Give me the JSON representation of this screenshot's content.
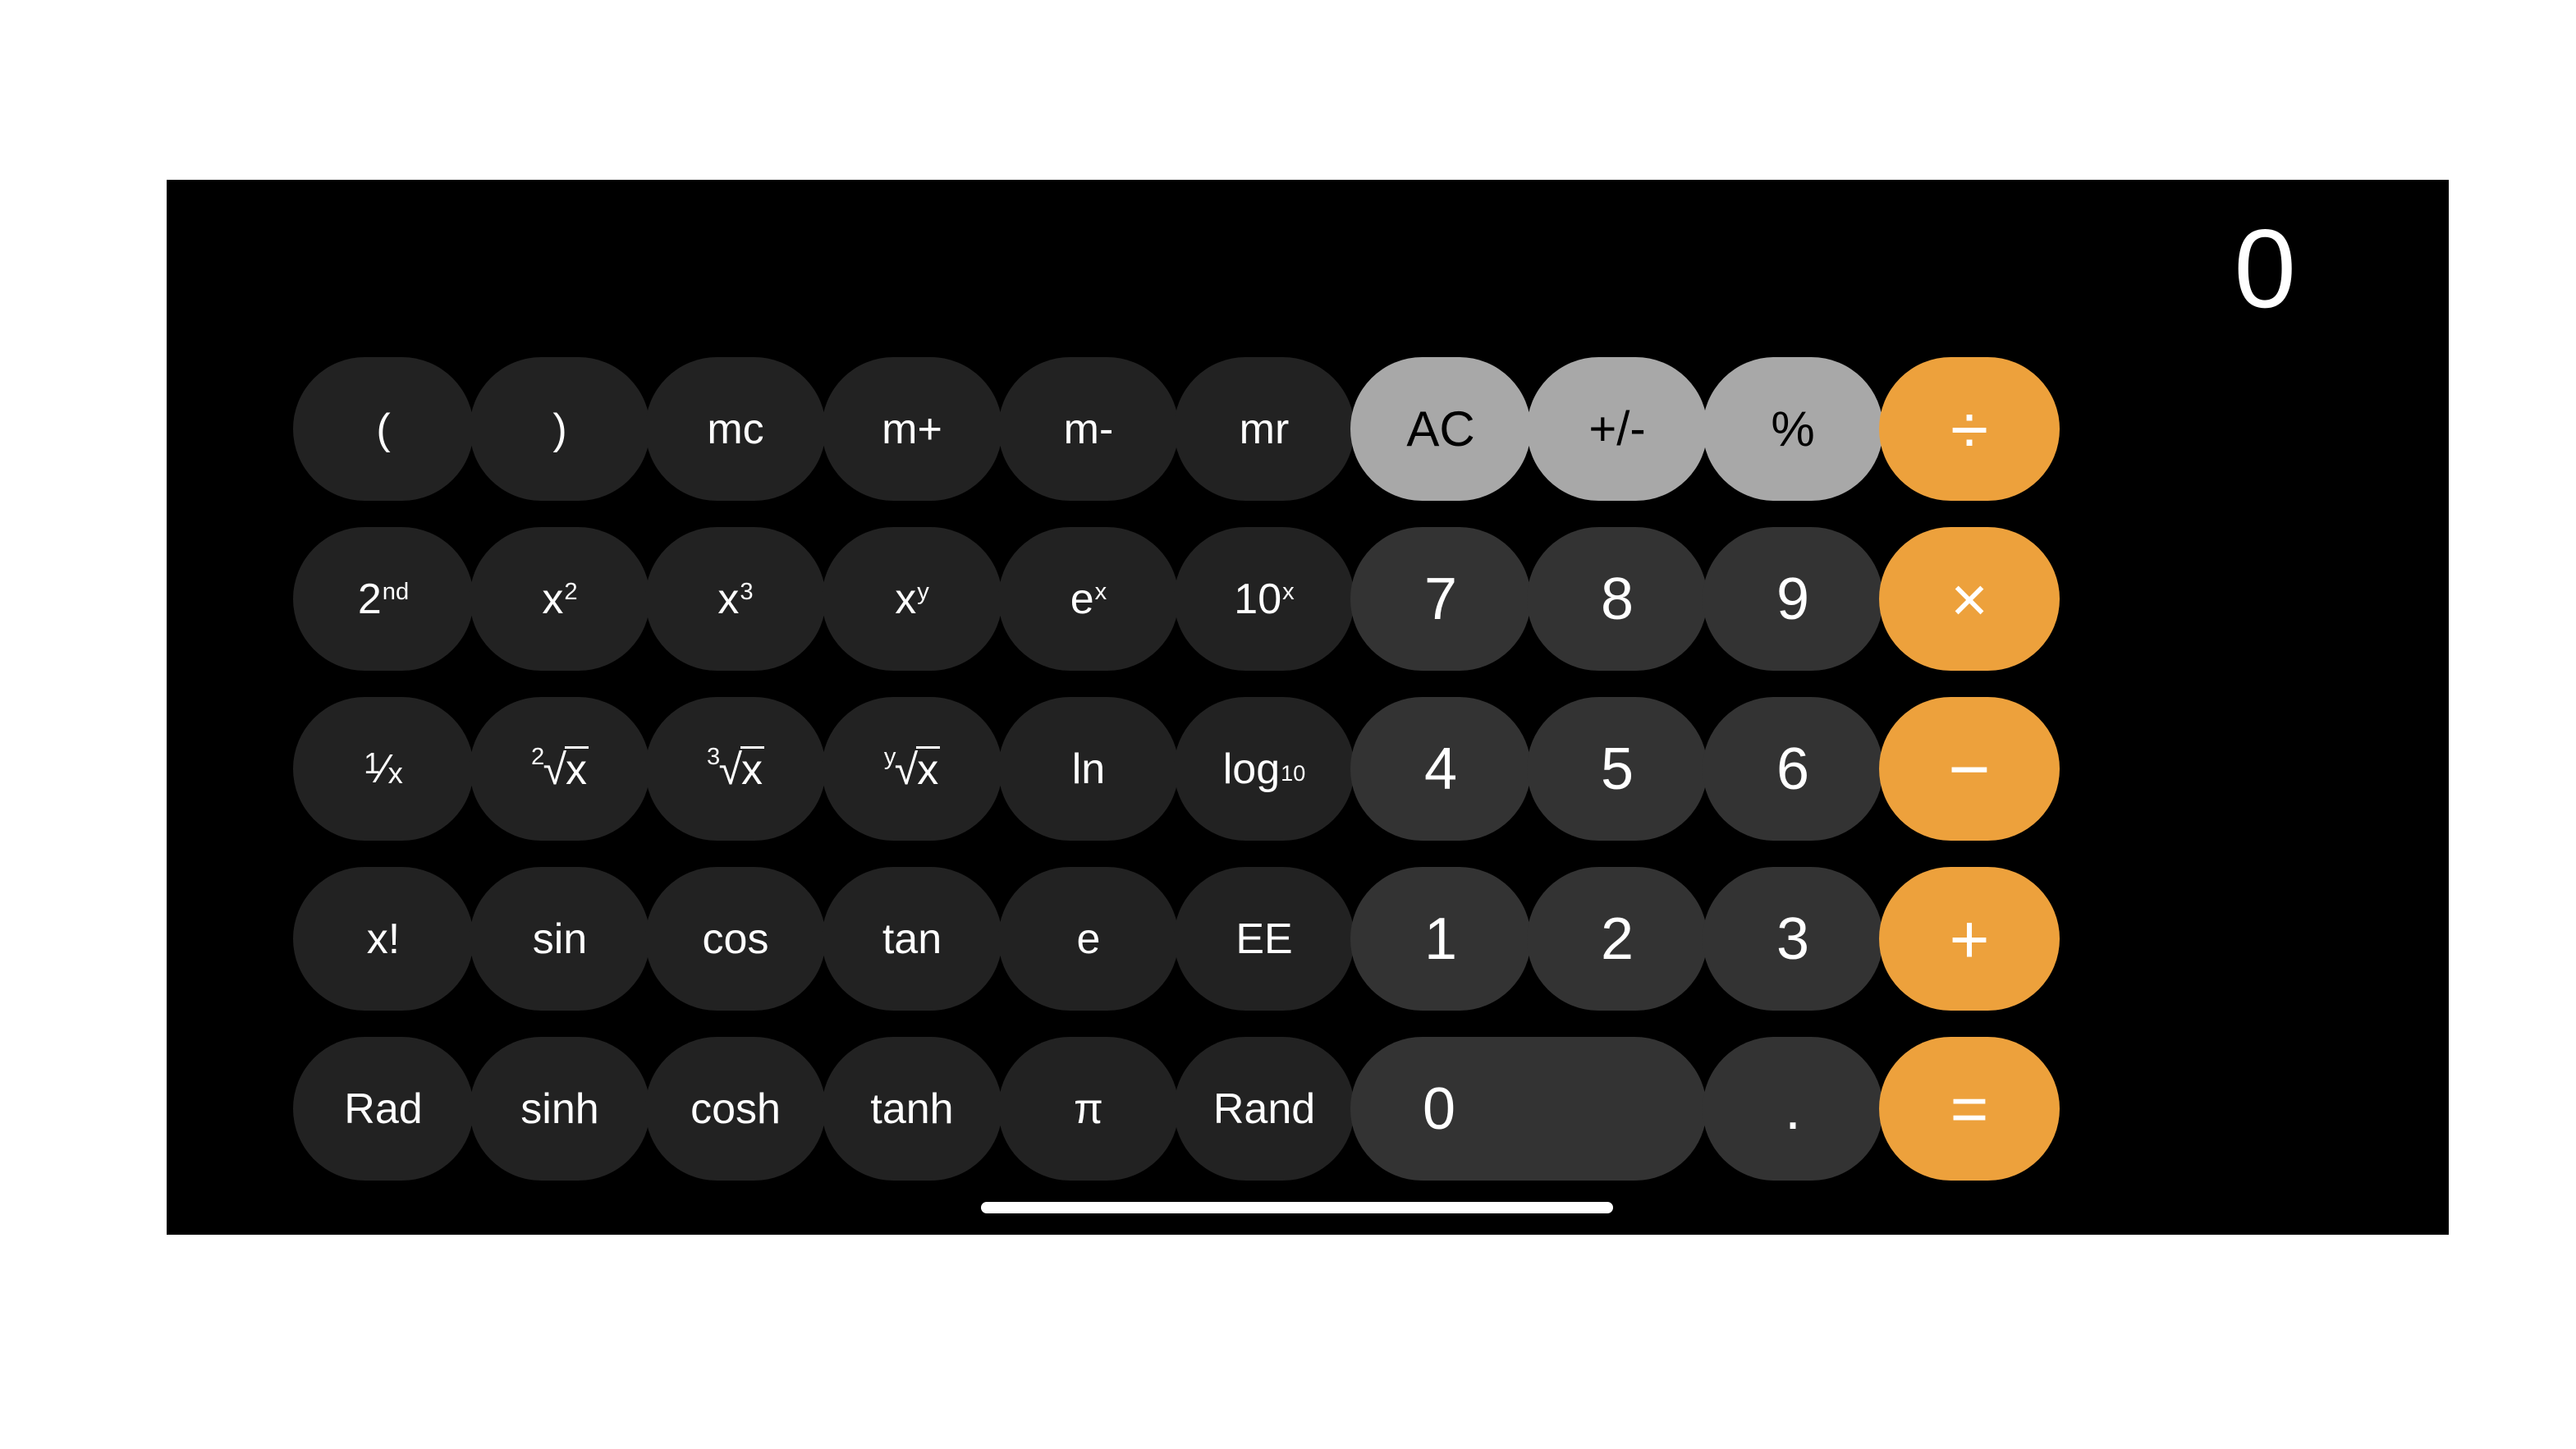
{
  "app": {
    "name": "Calculator",
    "mode": "scientific",
    "orientation": "landscape"
  },
  "display": {
    "value": "0"
  },
  "theme": {
    "background": "#000000",
    "function_key": "#222222",
    "number_key": "#333333",
    "utility_key": "#a8a8a8",
    "operator_key": "#eda13c",
    "text_light": "#ffffff",
    "text_dark": "#000000"
  },
  "keypad": {
    "rows": [
      {
        "index": 0,
        "keys": [
          {
            "name": "open-paren",
            "label": "(",
            "style": "fn"
          },
          {
            "name": "close-paren",
            "label": ")",
            "style": "fn"
          },
          {
            "name": "memory-clear",
            "label": "mc",
            "style": "fn"
          },
          {
            "name": "memory-add",
            "label": "m+",
            "style": "fn"
          },
          {
            "name": "memory-sub",
            "label": "m-",
            "style": "fn"
          },
          {
            "name": "memory-recall",
            "label": "mr",
            "style": "fn"
          },
          {
            "name": "all-clear",
            "label": "AC",
            "style": "util"
          },
          {
            "name": "sign-toggle",
            "label": "+/-",
            "style": "util"
          },
          {
            "name": "percent",
            "label": "%",
            "style": "util"
          },
          {
            "name": "divide",
            "label": "÷",
            "style": "op"
          }
        ]
      },
      {
        "index": 1,
        "keys": [
          {
            "name": "second-function",
            "label": "2nd",
            "base": "2",
            "sup": "nd",
            "style": "fn"
          },
          {
            "name": "x-squared",
            "label": "x²",
            "base": "x",
            "sup": "2",
            "style": "fn"
          },
          {
            "name": "x-cubed",
            "label": "x³",
            "base": "x",
            "sup": "3",
            "style": "fn"
          },
          {
            "name": "x-to-the-y",
            "label": "xy",
            "base": "x",
            "sup": "y",
            "style": "fn"
          },
          {
            "name": "e-to-the-x",
            "label": "ex",
            "base": "e",
            "sup": "x",
            "style": "fn"
          },
          {
            "name": "ten-to-the-x",
            "label": "10x",
            "base": "10",
            "sup": "x",
            "style": "fn"
          },
          {
            "name": "digit-7",
            "label": "7",
            "style": "num"
          },
          {
            "name": "digit-8",
            "label": "8",
            "style": "num"
          },
          {
            "name": "digit-9",
            "label": "9",
            "style": "num"
          },
          {
            "name": "multiply",
            "label": "×",
            "style": "op"
          }
        ]
      },
      {
        "index": 2,
        "keys": [
          {
            "name": "reciprocal",
            "label": "1/x",
            "style": "fn"
          },
          {
            "name": "square-root",
            "label": "2√x",
            "index": "2",
            "style": "fn"
          },
          {
            "name": "cube-root",
            "label": "3√x",
            "index": "3",
            "style": "fn"
          },
          {
            "name": "y-root",
            "label": "y√x",
            "index": "y",
            "style": "fn"
          },
          {
            "name": "natural-log",
            "label": "ln",
            "style": "fn"
          },
          {
            "name": "log-base-10",
            "label": "log10",
            "base": "log",
            "sub": "10",
            "style": "fn"
          },
          {
            "name": "digit-4",
            "label": "4",
            "style": "num"
          },
          {
            "name": "digit-5",
            "label": "5",
            "style": "num"
          },
          {
            "name": "digit-6",
            "label": "6",
            "style": "num"
          },
          {
            "name": "subtract",
            "label": "−",
            "style": "op"
          }
        ]
      },
      {
        "index": 3,
        "keys": [
          {
            "name": "factorial",
            "label": "x!",
            "style": "fn"
          },
          {
            "name": "sine",
            "label": "sin",
            "style": "fn"
          },
          {
            "name": "cosine",
            "label": "cos",
            "style": "fn"
          },
          {
            "name": "tangent",
            "label": "tan",
            "style": "fn"
          },
          {
            "name": "euler-e",
            "label": "e",
            "style": "fn"
          },
          {
            "name": "exponent-ee",
            "label": "EE",
            "style": "fn"
          },
          {
            "name": "digit-1",
            "label": "1",
            "style": "num"
          },
          {
            "name": "digit-2",
            "label": "2",
            "style": "num"
          },
          {
            "name": "digit-3",
            "label": "3",
            "style": "num"
          },
          {
            "name": "add",
            "label": "+",
            "style": "op"
          }
        ]
      },
      {
        "index": 4,
        "keys": [
          {
            "name": "angle-mode-rad",
            "label": "Rad",
            "style": "fn"
          },
          {
            "name": "hyperbolic-sine",
            "label": "sinh",
            "style": "fn"
          },
          {
            "name": "hyperbolic-cos",
            "label": "cosh",
            "style": "fn"
          },
          {
            "name": "hyperbolic-tan",
            "label": "tanh",
            "style": "fn"
          },
          {
            "name": "pi",
            "label": "π",
            "style": "fn"
          },
          {
            "name": "random",
            "label": "Rand",
            "style": "fn"
          },
          {
            "name": "digit-0",
            "label": "0",
            "style": "num"
          },
          {
            "name": "decimal-point",
            "label": ".",
            "style": "num"
          },
          {
            "name": "equals",
            "label": "=",
            "style": "op"
          }
        ]
      }
    ]
  },
  "system": {
    "home_indicator": "home-indicator"
  }
}
